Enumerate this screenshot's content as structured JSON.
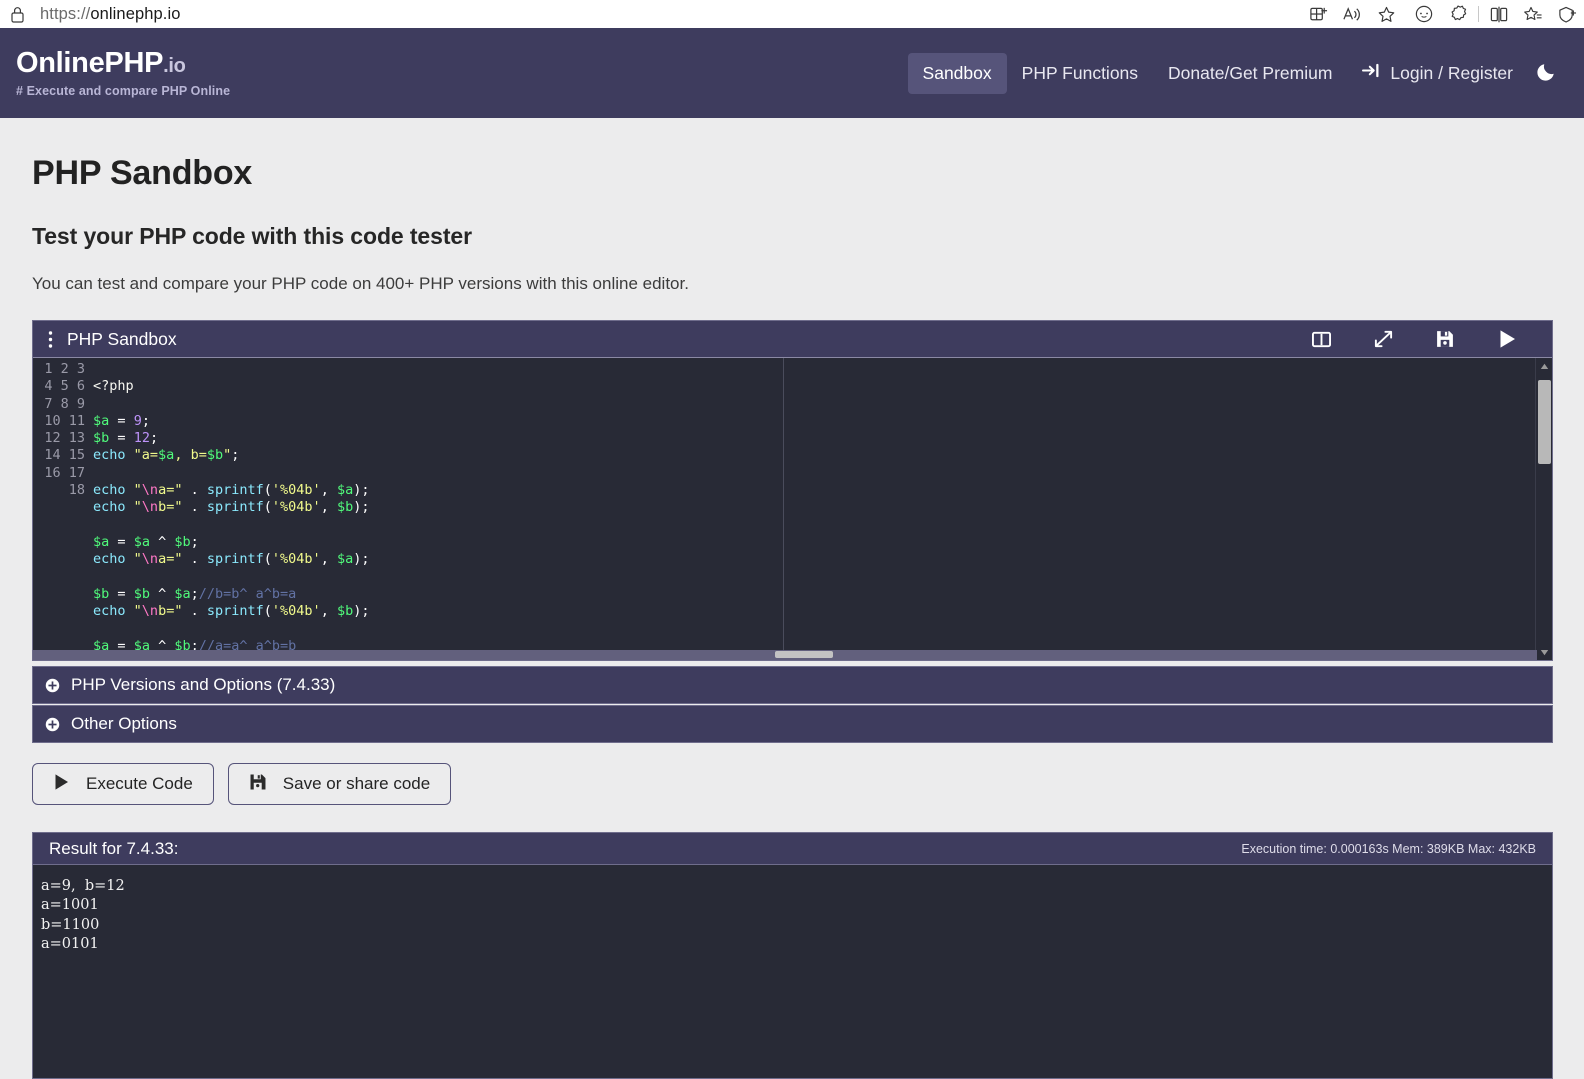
{
  "browser": {
    "url_scheme": "https://",
    "url_host": "onlinephp.io",
    "lock_icon": "lock-icon",
    "toolbar_icons": [
      "split-screen-add-icon",
      "read-aloud-icon",
      "favorite-star-icon",
      "copilot-icon",
      "extensions-icon",
      "split-screen-icon",
      "collections-icon",
      "browser-essentials-icon"
    ]
  },
  "site_header": {
    "brand_name": "OnlinePHP",
    "brand_suffix": ".io",
    "tagline": "# Execute and compare PHP Online",
    "nav": [
      {
        "label": "Sandbox",
        "active": true
      },
      {
        "label": "PHP Functions",
        "active": false
      },
      {
        "label": "Donate/Get Premium",
        "active": false
      }
    ],
    "login_label": "Login / Register",
    "login_icon": "sign-in-icon",
    "theme_toggle_icon": "moon-icon"
  },
  "page": {
    "title": "PHP Sandbox",
    "subtitle": "Test your PHP code with this code tester",
    "description": "You can test and compare your PHP code on 400+ PHP versions with this online editor."
  },
  "editor": {
    "title": "PHP Sandbox",
    "menu_icon": "kebab-menu-icon",
    "tools": [
      "split-view-icon",
      "expand-fullscreen-icon",
      "save-floppy-icon",
      "run-play-icon"
    ],
    "line_numbers": [
      1,
      2,
      3,
      4,
      5,
      6,
      7,
      8,
      9,
      10,
      11,
      12,
      13,
      14,
      15,
      16,
      17,
      18
    ],
    "code": "<?php\n\n$a = 9;\n$b = 12;\necho \"a=$a, b=$b\";\n\necho \"\\na=\" . sprintf('%04b', $a);\necho \"\\nb=\" . sprintf('%04b', $b);\n\n$a = $a ^ $b;\necho \"\\na=\" . sprintf('%04b', $a);\n\n$b = $b ^ $a;//b=b^ a^b=a\necho \"\\nb=\" . sprintf('%04b', $b);\n\n$a = $a ^ $b;//a=a^ a^b=b\n\necho \"\\na=$a, b=$b\";"
  },
  "accordions": [
    {
      "label": "PHP Versions and Options (7.4.33)",
      "icon": "plus-circle-icon"
    },
    {
      "label": "Other Options",
      "icon": "plus-circle-icon"
    }
  ],
  "buttons": [
    {
      "label": "Execute Code",
      "icon": "play-icon"
    },
    {
      "label": "Save or share code",
      "icon": "floppy-icon"
    }
  ],
  "result": {
    "title": "Result for 7.4.33:",
    "stats": "Execution time: 0.000163s Mem: 389KB Max: 432KB",
    "output": "a=9,  b=12\na=1001\nb=1100\na=0101"
  },
  "colors": {
    "header_navy": "#3e3c5e",
    "nav_active": "#56547a",
    "editor_bg": "#282a36",
    "page_bg": "#ececed"
  }
}
